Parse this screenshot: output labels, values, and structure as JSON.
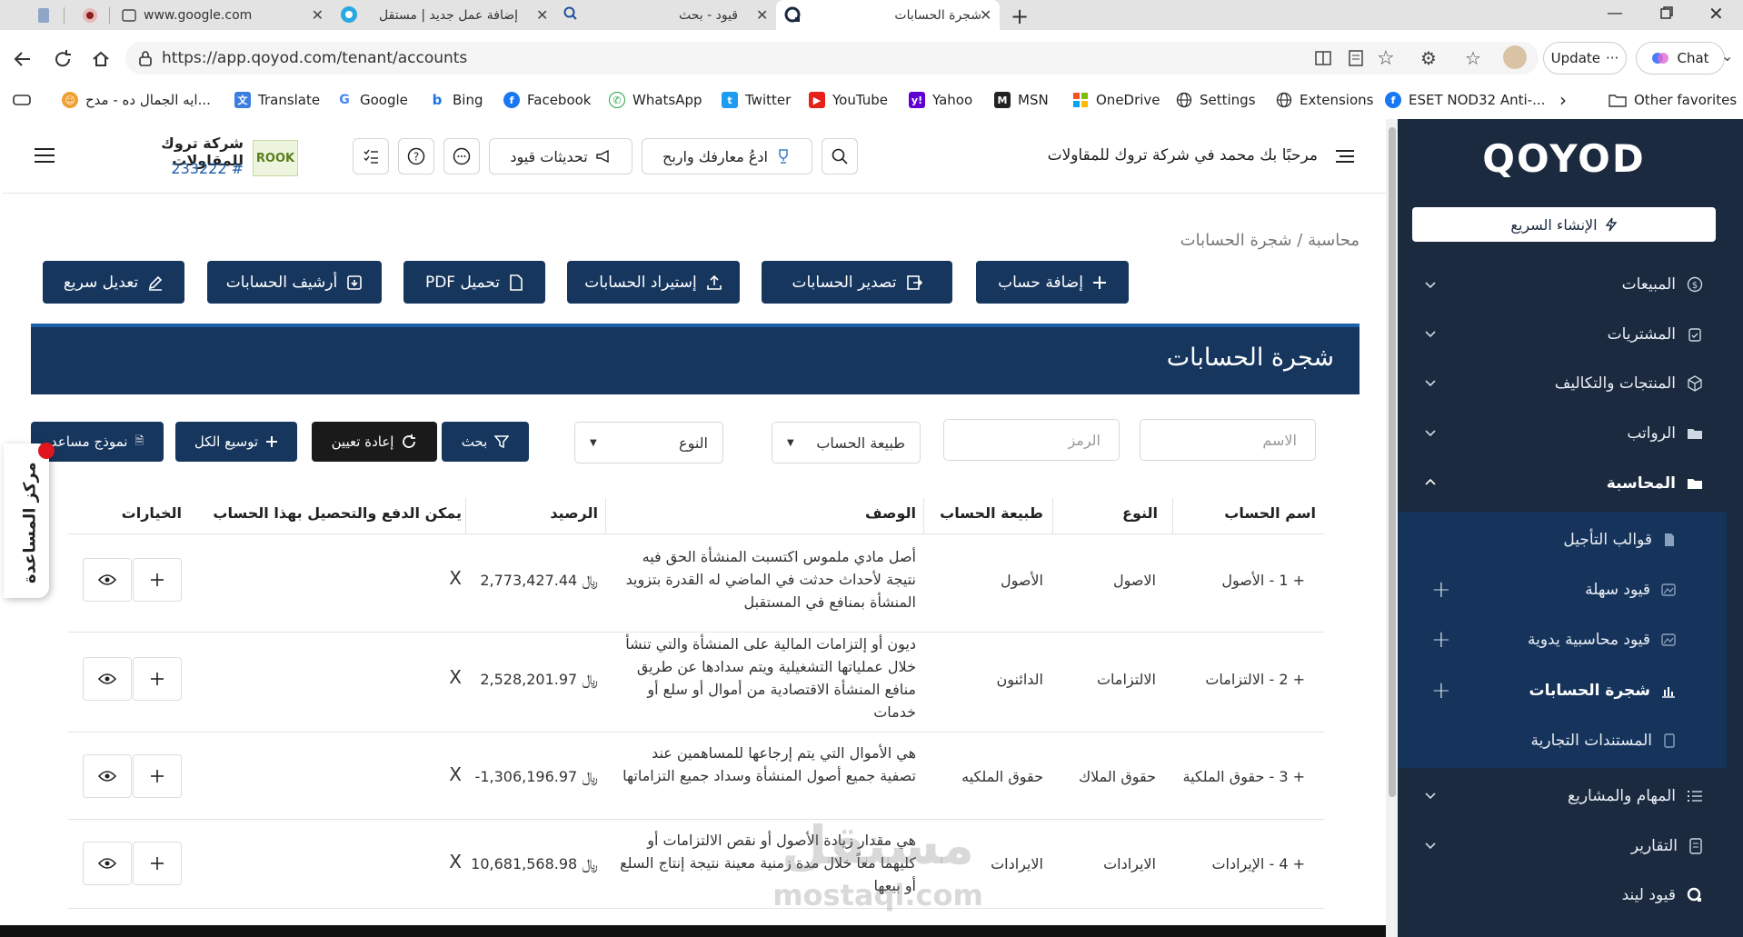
{
  "browser": {
    "tabs": [
      {
        "label": "www.google.com",
        "active": false
      },
      {
        "label": "إضافة عمل جديد | مستقل",
        "active": false
      },
      {
        "label": "قيود - بحث",
        "active": false
      },
      {
        "label": "شجرة الحسابات",
        "active": true
      }
    ],
    "url": "https://app.qoyod.com/tenant/accounts",
    "update_label": "Update",
    "chat_label": "Chat",
    "bookmarks": [
      "ايه الجمال ده - مدح...",
      "Translate",
      "Google",
      "Bing",
      "Facebook",
      "WhatsApp",
      "Twitter",
      "YouTube",
      "Yahoo",
      "MSN",
      "OneDrive",
      "Settings",
      "Extensions",
      "ESET NOD32 Anti-..."
    ],
    "other_favorites": "Other favorites"
  },
  "header": {
    "company_name": "شركة تروك للمقاولات",
    "company_id": "233222 #",
    "logo_text": "ROOK",
    "updates_label": "تحديثات قيود",
    "quiz_label": "ادعُ معارفك واربح",
    "welcome": "مرحبًا بك محمد في شركة تروك للمقاولات"
  },
  "breadcrumb": {
    "root": "محاسبة",
    "sep": "/",
    "current": "شجرة الحسابات"
  },
  "actions": {
    "add": "إضافة حساب",
    "export": "تصدير الحسابات",
    "import": "إستيراد الحسابات",
    "pdf": "تحميل PDF",
    "archive": "أرشيف الحسابات",
    "quick_edit": "تعديل سريع"
  },
  "page_title": "شجرة الحسابات",
  "filters": {
    "name_placeholder": "الاسم",
    "code_placeholder": "الرمز",
    "nature_select": "طبيعة الحساب",
    "type_select": "النوع",
    "search": "بحث",
    "reset": "إعادة تعيين",
    "expand": "توسيع الكل",
    "help_form": "نموذج مساعد"
  },
  "help_tab": "مركز المساعدة",
  "table": {
    "headers": {
      "name": "اسم الحساب",
      "type": "النوع",
      "nature": "طبيعة الحساب",
      "description": "الوصف",
      "balance": "الرصيد",
      "payable": "يمكن الدفع والتحصيل بهذا الحساب",
      "options": "الخيارات"
    },
    "rows": [
      {
        "name": "+ 1 - الأصول",
        "type": "الاصول",
        "nature": "الأصول",
        "description": "أصل مادي ملموس اكتسبت المنشأة الحق فيه نتيجة لأحداث حدثت في الماضي له القدرة بتزويد المنشأة بمنافع في المستقبل",
        "balance": "2,773,427.44 ﷼",
        "payable": "X"
      },
      {
        "name": "+ 2 - الالتزامات",
        "type": "الالتزامات",
        "nature": "الدائنون",
        "description": "ديون أو إلتزامات المالية على المنشأة والتي تنشأ خلال عملياتها التشغيلية ويتم سدادها عن طريق منافع المنشأة الاقتصادية من أموال أو سلع أو خدمات",
        "balance": "2,528,201.97 ﷼",
        "payable": "X"
      },
      {
        "name": "+ 3 - حقوق الملكية",
        "type": "حقوق الملاك",
        "nature": "حقوق الملكيه",
        "description": "هي الأموال التي يتم إرجاعها للمساهمين عند تصفية جميع أصول المنشأة وسداد جميع التزاماتها",
        "balance": "-1,306,196.97 ﷼",
        "payable": "X"
      },
      {
        "name": "+ 4 - الإيرادات",
        "type": "الايرادات",
        "nature": "الايرادات",
        "description": "هي مقدار زيادة الأصول أو نقص الالتزامات أو كليهما معاً خلال مدة زمنية معينة نتيجة إنتاج السلع أو بيعها",
        "balance": "10,681,568.98 ﷼",
        "payable": "X"
      }
    ]
  },
  "sidebar": {
    "brand": "QOYOD",
    "quick_create": "الإنشاء السريع",
    "items": [
      "المبيعات",
      "المشتريات",
      "المنتجات والتكاليف",
      "الرواتب",
      "المحاسبة"
    ],
    "subitems": [
      "قوالب التأجيل",
      "قيود سهلة",
      "قيود محاسبية يدوية",
      "شجرة الحسابات",
      "المستندات التجارية"
    ],
    "bottom_items": [
      "المهام والمشاريع",
      "التقارير",
      "قيود ليند"
    ]
  },
  "watermark": {
    "line1": "مستقل",
    "line2": "mostaql.com"
  },
  "colors": {
    "primary": "#16365e",
    "sidebar": "#1b2a3f",
    "submenu": "#16345b"
  }
}
